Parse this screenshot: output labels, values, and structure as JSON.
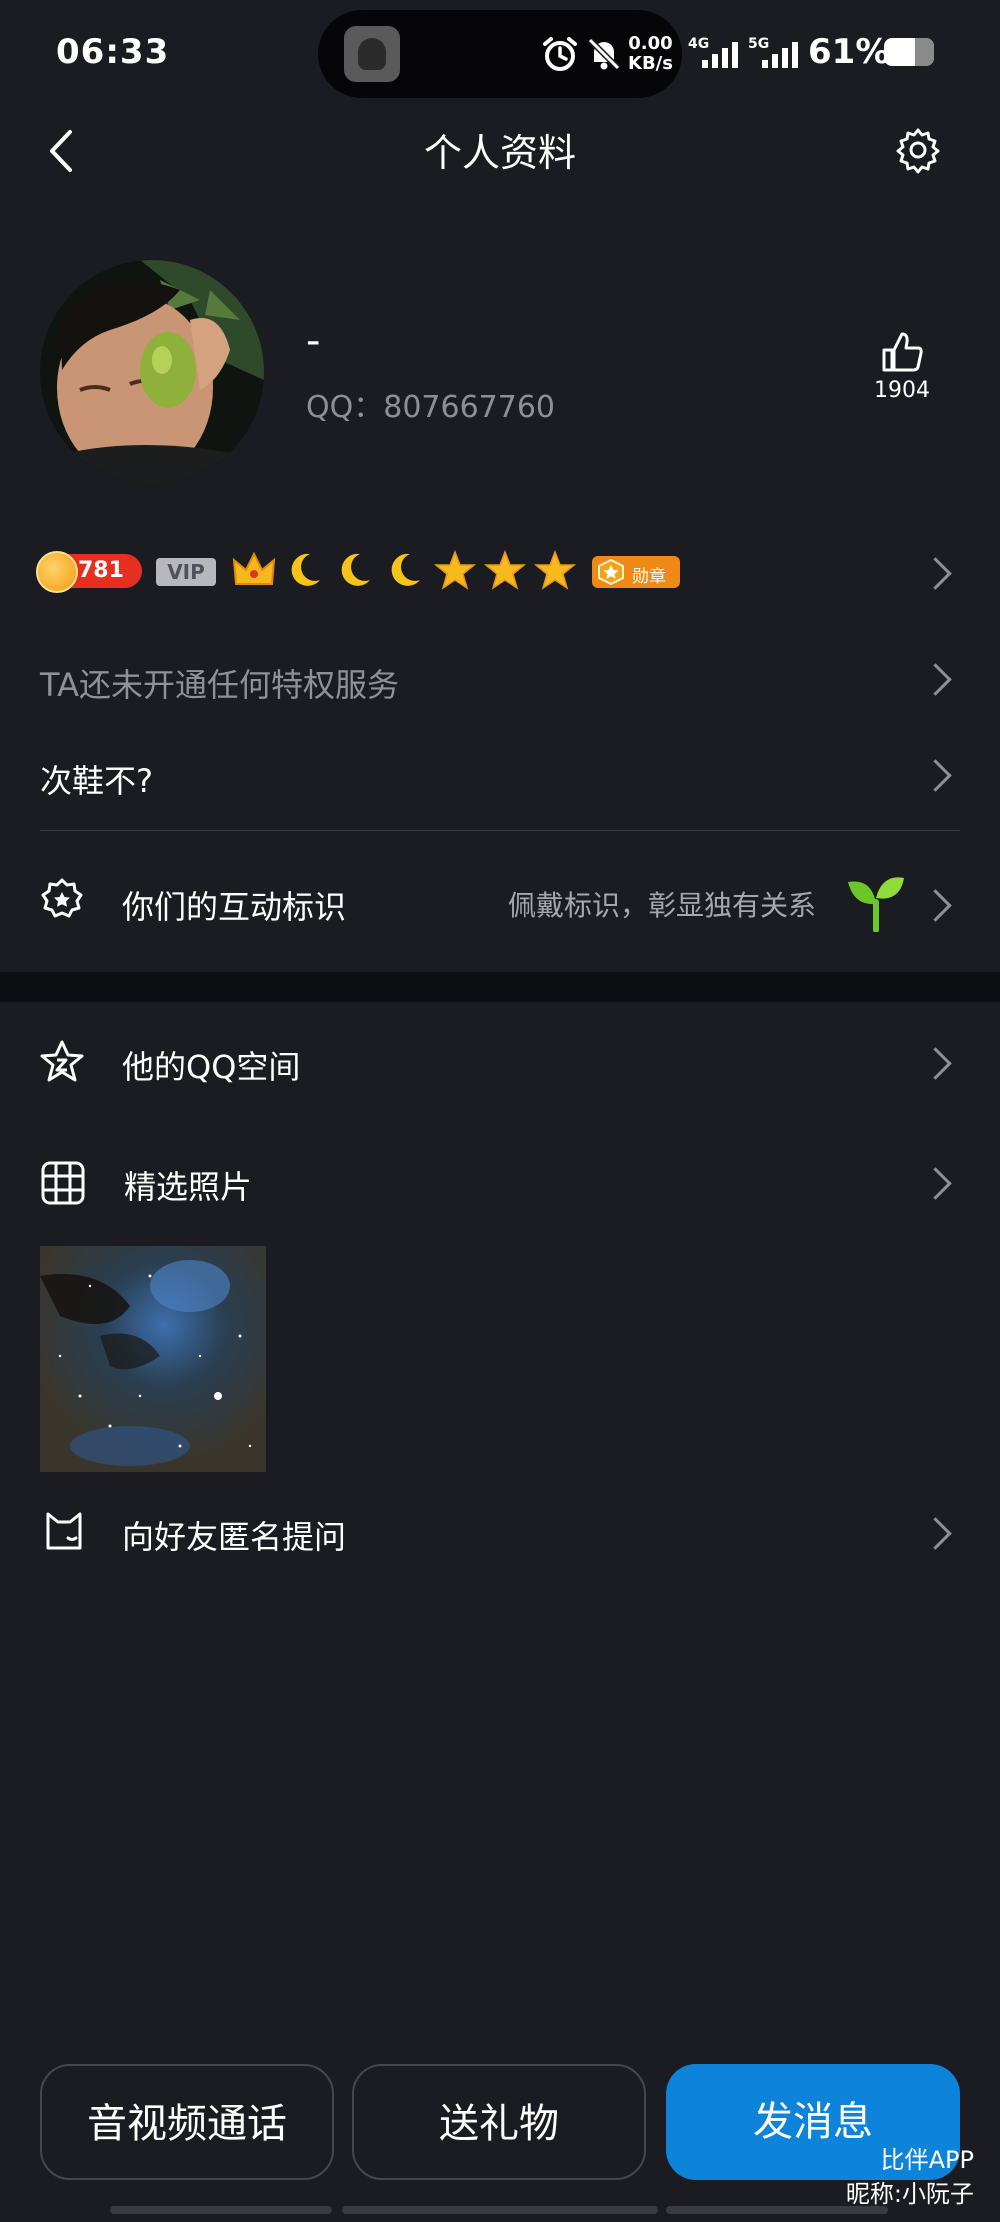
{
  "status_bar": {
    "time": "06:33",
    "net_speed_value": "0.00",
    "net_speed_unit": "KB/s",
    "network_1": "4G",
    "network_2": "5G",
    "battery_percent": "61%",
    "battery_level": 0.61
  },
  "header": {
    "title": "个人资料"
  },
  "profile": {
    "nickname": "-",
    "qq_label": "QQ：",
    "qq_number": "807667760",
    "likes": "1904"
  },
  "badges": {
    "level": "781",
    "vip": "VIP",
    "medal": "勋章",
    "crowns": 1,
    "moons": 3,
    "stars": 3
  },
  "rows": {
    "privilege": "TA还未开通任何特权服务",
    "signature": "次鞋不?",
    "interaction_label": "你们的互动标识",
    "interaction_hint": "佩戴标识，彰显独有关系",
    "qzone": "他的QQ空间",
    "photos": "精选照片",
    "anon_question": "向好友匿名提问"
  },
  "buttons": {
    "call": "音视频通话",
    "gift": "送礼物",
    "message": "发消息"
  },
  "watermark": {
    "line1": "比伴APP",
    "line2": "昵称:小阮子"
  },
  "colors": {
    "background": "#1b1c21",
    "accent": "#0d84d9",
    "muted_text": "#8d8f95"
  }
}
